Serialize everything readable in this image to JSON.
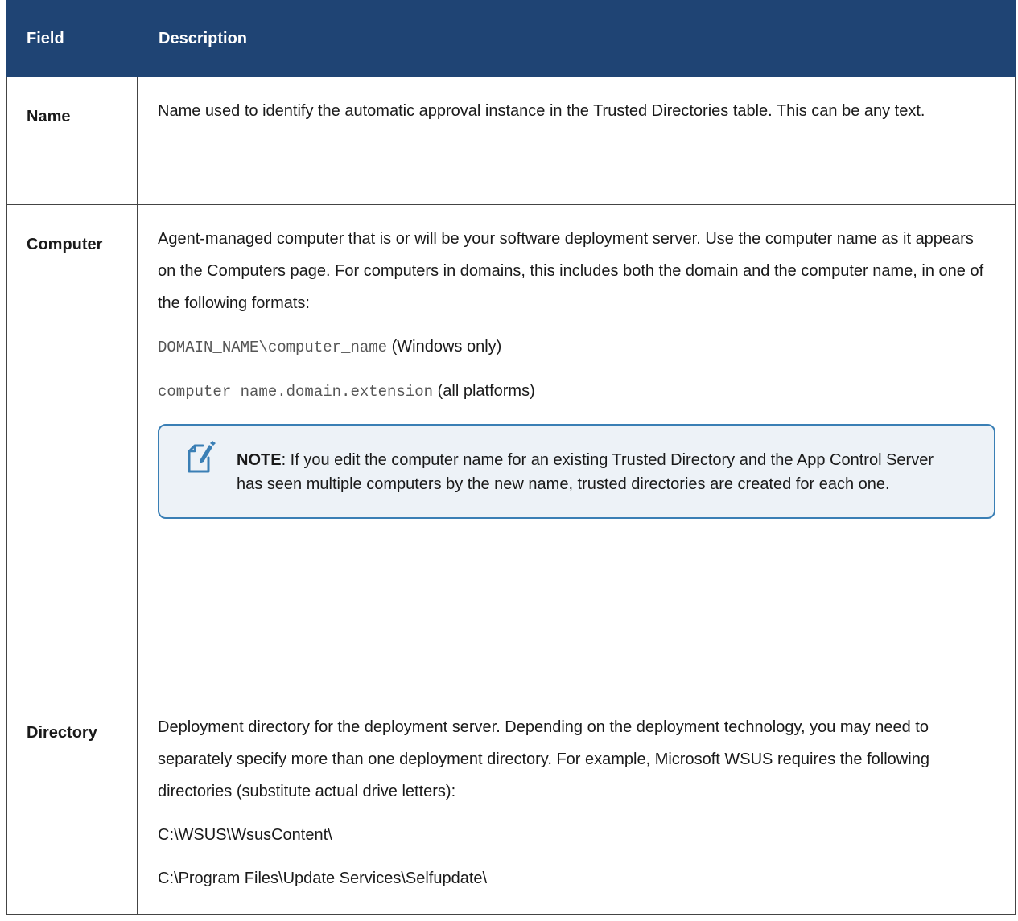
{
  "table": {
    "headers": {
      "field": "Field",
      "description": "Description"
    },
    "rows": {
      "name": {
        "field": "Name",
        "description": "Name used to identify the automatic approval instance in the Trusted Directories table. This can be any text."
      },
      "computer": {
        "field": "Computer",
        "description": "Agent-managed computer that is or will be your software deployment server. Use the computer name as it appears on the Computers page. For computers in domains, this includes both the domain and the computer name, in one of the following formats:",
        "format1_code": "DOMAIN_NAME\\computer_name",
        "format1_note": " (Windows only)",
        "format2_code": "computer_name.domain.extension",
        "format2_note": " (all platforms)",
        "note": {
          "icon": "note-edit-icon",
          "label": "NOTE",
          "text": ": If you edit the computer name for an existing Trusted Directory and the App Control Server has seen multiple computers by the new name, trusted directories are created for each one."
        }
      },
      "directory": {
        "field": "Directory",
        "description": "Deployment directory for the deployment server. Depending on the deployment technology, you may need to separately specify more than one deployment directory. For example, Microsoft WSUS requires the following directories (substitute actual drive letters):",
        "path1": "C:\\WSUS\\WsusContent\\",
        "path2": "C:\\Program Files\\Update Services\\Selfupdate\\"
      }
    }
  },
  "colors": {
    "header_bg": "#1f4474",
    "note_bg": "#edf2f7",
    "note_border": "#3a7fb5"
  }
}
